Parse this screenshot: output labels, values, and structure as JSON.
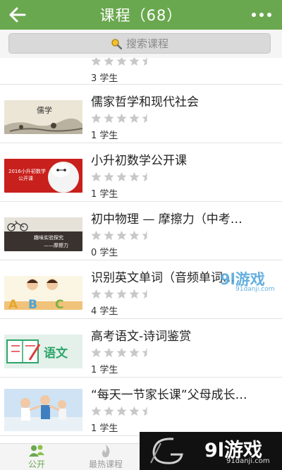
{
  "header": {
    "title": "课程（68）"
  },
  "search": {
    "placeholder": "搜索课程"
  },
  "courses": [
    {
      "title": "",
      "rating": 4.5,
      "students": "3 学生"
    },
    {
      "title": "儒家哲学和现代社会",
      "rating": 4.5,
      "students": "1 学生",
      "thumb_text": "儒学"
    },
    {
      "title": "小升初数学公开课",
      "rating": 4.5,
      "students": "1 学生",
      "thumb_text": "2016小升初数学\n公开课"
    },
    {
      "title": "初中物理 — 摩擦力（中考…",
      "rating": 4.5,
      "students": "0 学生",
      "thumb_text": "趣味实验探究\n——摩擦力"
    },
    {
      "title": "识别英文单词（音频单词…",
      "rating": 4.5,
      "students": "4 学生",
      "thumb_text": "ABC"
    },
    {
      "title": "高考语文-诗词鉴赏",
      "rating": 4.5,
      "students": "1 学生",
      "thumb_text": "语文"
    },
    {
      "title": "“每天一节家长课”父母成长…",
      "rating": 4.5,
      "students": "1 学生"
    }
  ],
  "tabbar": {
    "tabs": [
      {
        "label": "公开"
      },
      {
        "label": "最热课程"
      }
    ]
  },
  "watermark": {
    "logo": "9l游戏",
    "url": "91danji.com",
    "logo2": "9l游戏",
    "url2": "91danji.com"
  },
  "colors": {
    "header": "#6aa84f",
    "accent": "#6aa84f",
    "star": "#c8c8c8"
  }
}
